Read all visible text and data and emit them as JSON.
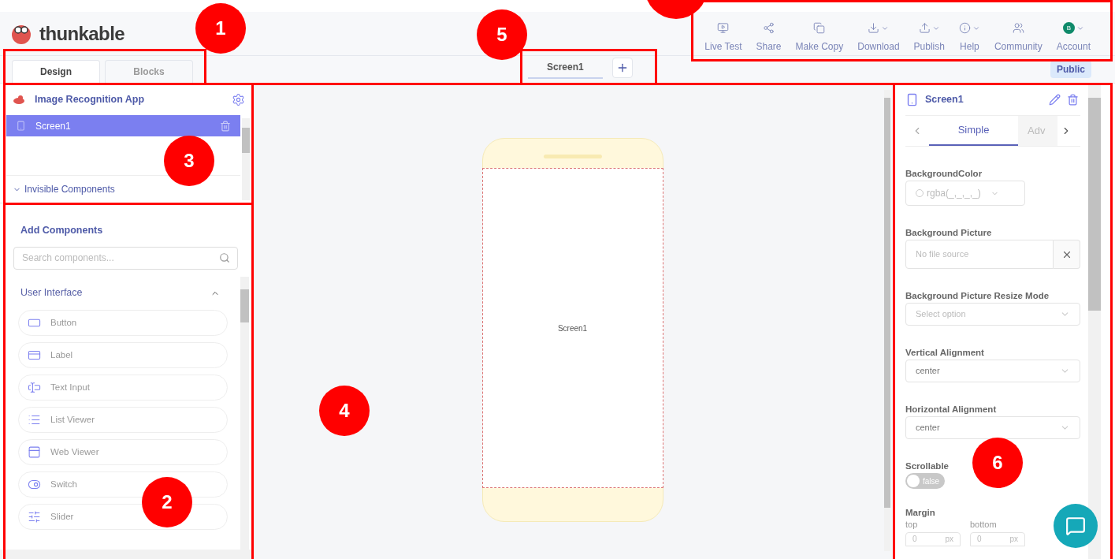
{
  "header": {
    "logo_text": "thunkable",
    "toolbar": [
      {
        "label": "Live Test",
        "kind": "live-test",
        "dropdown": false
      },
      {
        "label": "Share",
        "kind": "share",
        "dropdown": false
      },
      {
        "label": "Make Copy",
        "kind": "copy",
        "dropdown": false
      },
      {
        "label": "Download",
        "kind": "download",
        "dropdown": true
      },
      {
        "label": "Publish",
        "kind": "publish",
        "dropdown": true
      },
      {
        "label": "Help",
        "kind": "help",
        "dropdown": true
      },
      {
        "label": "Community",
        "kind": "community",
        "dropdown": false
      },
      {
        "label": "Account",
        "kind": "account",
        "dropdown": true,
        "avatar": "B"
      }
    ]
  },
  "mode_tabs": [
    {
      "label": "Design",
      "selected": true
    },
    {
      "label": "Blocks",
      "selected": false
    }
  ],
  "screen_tabs": [
    {
      "label": "Screen1",
      "selected": true
    }
  ],
  "visibility_badge": "Public",
  "project": {
    "title": "Image Recognition App",
    "screens": [
      {
        "name": "Screen1",
        "selected": true
      }
    ],
    "invisible_components": {
      "label": "Invisible Components",
      "expanded": true
    }
  },
  "add_components": {
    "title": "Add Components",
    "search_placeholder": "Search components...",
    "category": {
      "label": "User Interface",
      "expanded": true
    },
    "items": [
      {
        "label": "Button",
        "kind": "button"
      },
      {
        "label": "Label",
        "kind": "label"
      },
      {
        "label": "Text Input",
        "kind": "text-input"
      },
      {
        "label": "List Viewer",
        "kind": "list-viewer"
      },
      {
        "label": "Web Viewer",
        "kind": "web-viewer"
      },
      {
        "label": "Switch",
        "kind": "switch"
      },
      {
        "label": "Slider",
        "kind": "slider"
      }
    ]
  },
  "canvas": {
    "screen_label": "Screen1"
  },
  "properties": {
    "title": "Screen1",
    "tabs": [
      {
        "label": "Simple",
        "selected": true
      },
      {
        "label": "Adv",
        "selected": false
      }
    ],
    "fields": [
      {
        "kind": "color",
        "label": "BackgroundColor",
        "value": "rgba(_,_,_,_)"
      },
      {
        "kind": "file",
        "label": "Background Picture",
        "placeholder": "No file source"
      },
      {
        "kind": "select",
        "label": "Background Picture Resize Mode",
        "placeholder": "Select option"
      },
      {
        "kind": "select",
        "label": "Vertical Alignment",
        "value": "center"
      },
      {
        "kind": "select",
        "label": "Horizontal Alignment",
        "value": "center"
      },
      {
        "kind": "toggle",
        "label": "Scrollable",
        "on": false,
        "value": "false"
      },
      {
        "kind": "margin",
        "label": "Margin",
        "inputs": [
          {
            "label": "top",
            "value": "0",
            "unit": "px"
          },
          {
            "label": "bottom",
            "value": "0",
            "unit": "px"
          }
        ]
      }
    ]
  },
  "callouts": [
    {
      "number": "1"
    },
    {
      "number": "5"
    },
    {
      "number": "3"
    },
    {
      "number": "4"
    },
    {
      "number": "2"
    },
    {
      "number": "6"
    }
  ]
}
